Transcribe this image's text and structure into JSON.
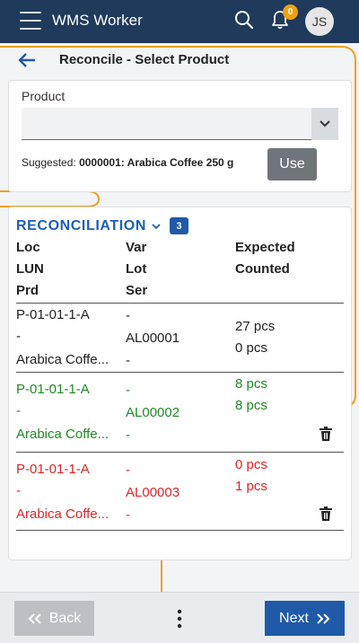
{
  "app": {
    "title": "WMS Worker",
    "notification_count": "0",
    "user_initials": "JS"
  },
  "page": {
    "title": "Reconcile - Select Product"
  },
  "product_card": {
    "label": "Product",
    "selected_value": "",
    "suggested_prefix": "Suggested:",
    "suggested_value": "0000001: Arabica Coffee 250 g",
    "use_label": "Use"
  },
  "reconciliation": {
    "title": "RECONCILIATION",
    "count": "3",
    "headers": {
      "col1": [
        "Loc",
        "LUN",
        "Prd"
      ],
      "col2": [
        "Var",
        "Lot",
        "Ser"
      ],
      "col3": [
        "Expected",
        "Counted"
      ]
    },
    "rows": [
      {
        "loc": "P-01-01-1-A",
        "lun": "-",
        "prd": "Arabica Coffe...",
        "var": "-",
        "lot": "AL00001",
        "ser": "-",
        "expected": "27 pcs",
        "counted": "0 pcs",
        "status": "neutral",
        "deletable": false
      },
      {
        "loc": "P-01-01-1-A",
        "lun": "-",
        "prd": "Arabica Coffe...",
        "var": "-",
        "lot": "AL00002",
        "ser": "-",
        "expected": "8 pcs",
        "counted": "8 pcs",
        "status": "match",
        "deletable": true
      },
      {
        "loc": "P-01-01-1-A",
        "lun": "-",
        "prd": "Arabica Coffe...",
        "var": "-",
        "lot": "AL00003",
        "ser": "-",
        "expected": "0 pcs",
        "counted": "1 pcs",
        "status": "mismatch",
        "deletable": true
      }
    ]
  },
  "footer": {
    "back_label": "Back",
    "next_label": "Next"
  },
  "colors": {
    "header_bg": "#1f3a5a",
    "accent": "#1f5aa8",
    "match": "#1e8a23",
    "mismatch": "#e02424",
    "badge": "#f0a010"
  }
}
